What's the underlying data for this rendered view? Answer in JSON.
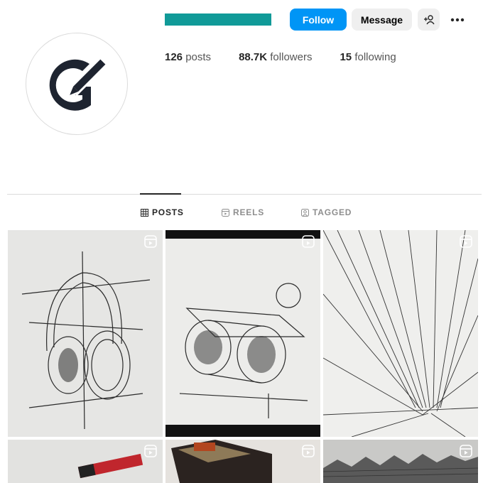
{
  "header": {
    "username_redacted": true,
    "buttons": {
      "follow": "Follow",
      "message": "Message"
    },
    "stats": [
      {
        "value": "126",
        "label": "posts"
      },
      {
        "value": "88.7K",
        "label": "followers"
      },
      {
        "value": "15",
        "label": "following"
      }
    ]
  },
  "tabs": [
    {
      "label": "POSTS",
      "icon": "grid-icon",
      "active": true
    },
    {
      "label": "REELS",
      "icon": "reels-icon",
      "active": false
    },
    {
      "label": "TAGGED",
      "icon": "tagged-icon",
      "active": false
    }
  ],
  "posts": [
    {
      "subject": "headphones sketch",
      "type": "reel"
    },
    {
      "subject": "binoculars sketch",
      "type": "reel"
    },
    {
      "subject": "perspective building sketch",
      "type": "reel"
    },
    {
      "subject": "marker pen",
      "type": "reel"
    },
    {
      "subject": "book box",
      "type": "reel"
    },
    {
      "subject": "city sketch",
      "type": "reel"
    }
  ],
  "colors": {
    "accent": "#0095f6",
    "redaction": "#109a98",
    "text": "#262626",
    "muted": "#8e8e8e"
  }
}
